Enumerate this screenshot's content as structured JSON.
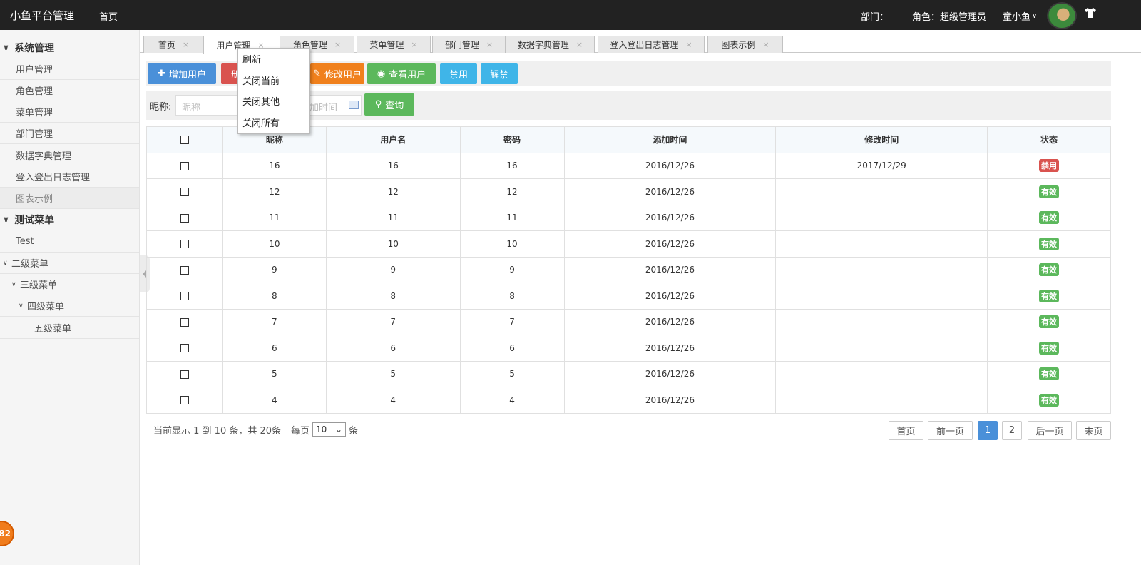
{
  "topbar": {
    "brand": "小鱼平台管理",
    "home": "首页",
    "dept_label": "部门：",
    "role_label": "角色：",
    "role_value": "超级管理员",
    "user_name": "童小鱼",
    "user_chevron": "∨"
  },
  "sidebar": {
    "items": [
      {
        "label": "系统管理",
        "type": "group"
      },
      {
        "label": "用户管理"
      },
      {
        "label": "角色管理"
      },
      {
        "label": "菜单管理"
      },
      {
        "label": "部门管理"
      },
      {
        "label": "数据字典管理"
      },
      {
        "label": "登入登出日志管理"
      },
      {
        "label": "图表示例",
        "active": true
      },
      {
        "label": "测试菜单",
        "type": "group"
      },
      {
        "label": "Test"
      },
      {
        "label": "二级菜单"
      },
      {
        "label": "三级菜单"
      },
      {
        "label": "四级菜单"
      },
      {
        "label": "五级菜单"
      }
    ],
    "badge": "82"
  },
  "tabs": [
    {
      "label": "首页"
    },
    {
      "label": "用户管理",
      "active": true
    },
    {
      "label": "角色管理"
    },
    {
      "label": "菜单管理"
    },
    {
      "label": "部门管理"
    },
    {
      "label": "数据字典管理"
    },
    {
      "label": "登入登出日志管理"
    },
    {
      "label": "图表示例"
    }
  ],
  "tab_close": "×",
  "context_menu": [
    "刷新",
    "关闭当前",
    "关闭其他",
    "关闭所有"
  ],
  "toolbar": {
    "add": "增加用户",
    "delete_partial": "册",
    "edit": "修改用户",
    "view": "查看用户",
    "disable": "禁用",
    "enable": "解禁"
  },
  "search": {
    "nickname_label": "昵称:",
    "nickname_placeholder": "昵称",
    "date_placeholder": "加时间",
    "query_button": "查询"
  },
  "table": {
    "headers": [
      "昵称",
      "用户名",
      "密码",
      "添加时间",
      "修改时间",
      "状态"
    ],
    "rows": [
      {
        "nick": "16",
        "user": "16",
        "pwd": "16",
        "add": "2016/12/26",
        "mod": "2017/12/29",
        "status": "禁用"
      },
      {
        "nick": "12",
        "user": "12",
        "pwd": "12",
        "add": "2016/12/26",
        "mod": "",
        "status": "有效"
      },
      {
        "nick": "11",
        "user": "11",
        "pwd": "11",
        "add": "2016/12/26",
        "mod": "",
        "status": "有效"
      },
      {
        "nick": "10",
        "user": "10",
        "pwd": "10",
        "add": "2016/12/26",
        "mod": "",
        "status": "有效"
      },
      {
        "nick": "9",
        "user": "9",
        "pwd": "9",
        "add": "2016/12/26",
        "mod": "",
        "status": "有效"
      },
      {
        "nick": "8",
        "user": "8",
        "pwd": "8",
        "add": "2016/12/26",
        "mod": "",
        "status": "有效"
      },
      {
        "nick": "7",
        "user": "7",
        "pwd": "7",
        "add": "2016/12/26",
        "mod": "",
        "status": "有效"
      },
      {
        "nick": "6",
        "user": "6",
        "pwd": "6",
        "add": "2016/12/26",
        "mod": "",
        "status": "有效"
      },
      {
        "nick": "5",
        "user": "5",
        "pwd": "5",
        "add": "2016/12/26",
        "mod": "",
        "status": "有效"
      },
      {
        "nick": "4",
        "user": "4",
        "pwd": "4",
        "add": "2016/12/26",
        "mod": "",
        "status": "有效"
      }
    ]
  },
  "status_colors": {
    "禁用": "#d9534f",
    "有效": "#5cb85c"
  },
  "pagination": {
    "info": "当前显示 1 到 10 条，共 20条",
    "per_page_label": "每页",
    "per_page_value": "10",
    "per_page_unit": "条",
    "buttons": [
      "首页",
      "前一页",
      "1",
      "2",
      "后一页",
      "末页"
    ],
    "current": "1"
  }
}
